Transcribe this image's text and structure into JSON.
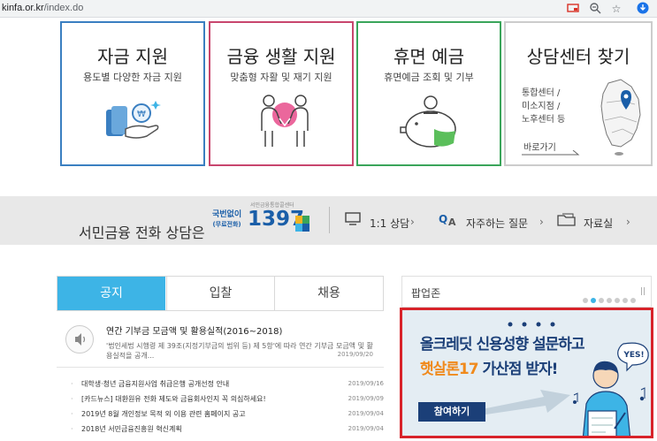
{
  "browser": {
    "url_host": "kinfa.or.kr",
    "url_path": "/index.do"
  },
  "cards": [
    {
      "title": "자금 지원",
      "subtitle": "용도별 다양한 자금 지원",
      "border": "#3a7fc1"
    },
    {
      "title": "금융 생활 지원",
      "subtitle": "맞춤형 자활 및 재기 지원",
      "border": "#c8466e"
    },
    {
      "title": "휴면 예금",
      "subtitle": "휴면예금 조회 및 기부",
      "border": "#3aa55a"
    },
    {
      "title": "상담센터 찾기",
      "border": "#cccccc",
      "list": [
        "통합센터 /",
        "미소지점 /",
        "노후센터 등"
      ],
      "more": "바로가기"
    }
  ],
  "hotline": {
    "title": "서민금융 전화 상담은",
    "center_name": "서민금융통합콜센터",
    "tag_line1": "국번없이",
    "tag_line2": "(무료전화)",
    "number": "1397",
    "links": [
      "1:1 상담",
      "자주하는 질문",
      "자료실"
    ]
  },
  "tabs": {
    "items": [
      "공지",
      "입찰",
      "채용"
    ],
    "active": 0
  },
  "notice_main": {
    "title": "연간 기부금 모금액 및 활용실적(2016~2018)",
    "desc": "'법인세법 시행령 제 39조(지정기부금의 범위 등) 제 5항'에 따라 연간 기부금 모금액 및 활용실적을 공개...",
    "date": "2019/09/20"
  },
  "notices": [
    {
      "text": "대학생·청년 금융지원사업 취급은행 공개선정 안내",
      "date": "2019/09/16"
    },
    {
      "text": "[카드뉴스] 대환원유 전화 제도와 금융회사인지 꼭 의심하세요!",
      "date": "2019/09/09"
    },
    {
      "text": "2019년 8월 개인정보 목적 외 이용 관련 홈페이지 공고",
      "date": "2019/09/04"
    },
    {
      "text": "2018년 서민금융진흥원 혁신계획",
      "date": "2019/09/04"
    }
  ],
  "popup": {
    "title": "팝업존",
    "pause": "||",
    "dot_count": 7,
    "active_dot": 1
  },
  "banner": {
    "line1": "올크레딧 신용성향 설문하고",
    "line2_highlight": "햇살론17",
    "line2_rest": " 가산점 받자!",
    "button": "참여하기",
    "bubble": "YES!"
  },
  "colors": {
    "accent": "#3db4e6",
    "hotline_blue": "#1a5ea8",
    "banner_border": "#d8232a",
    "banner_orange": "#f08a1c"
  }
}
